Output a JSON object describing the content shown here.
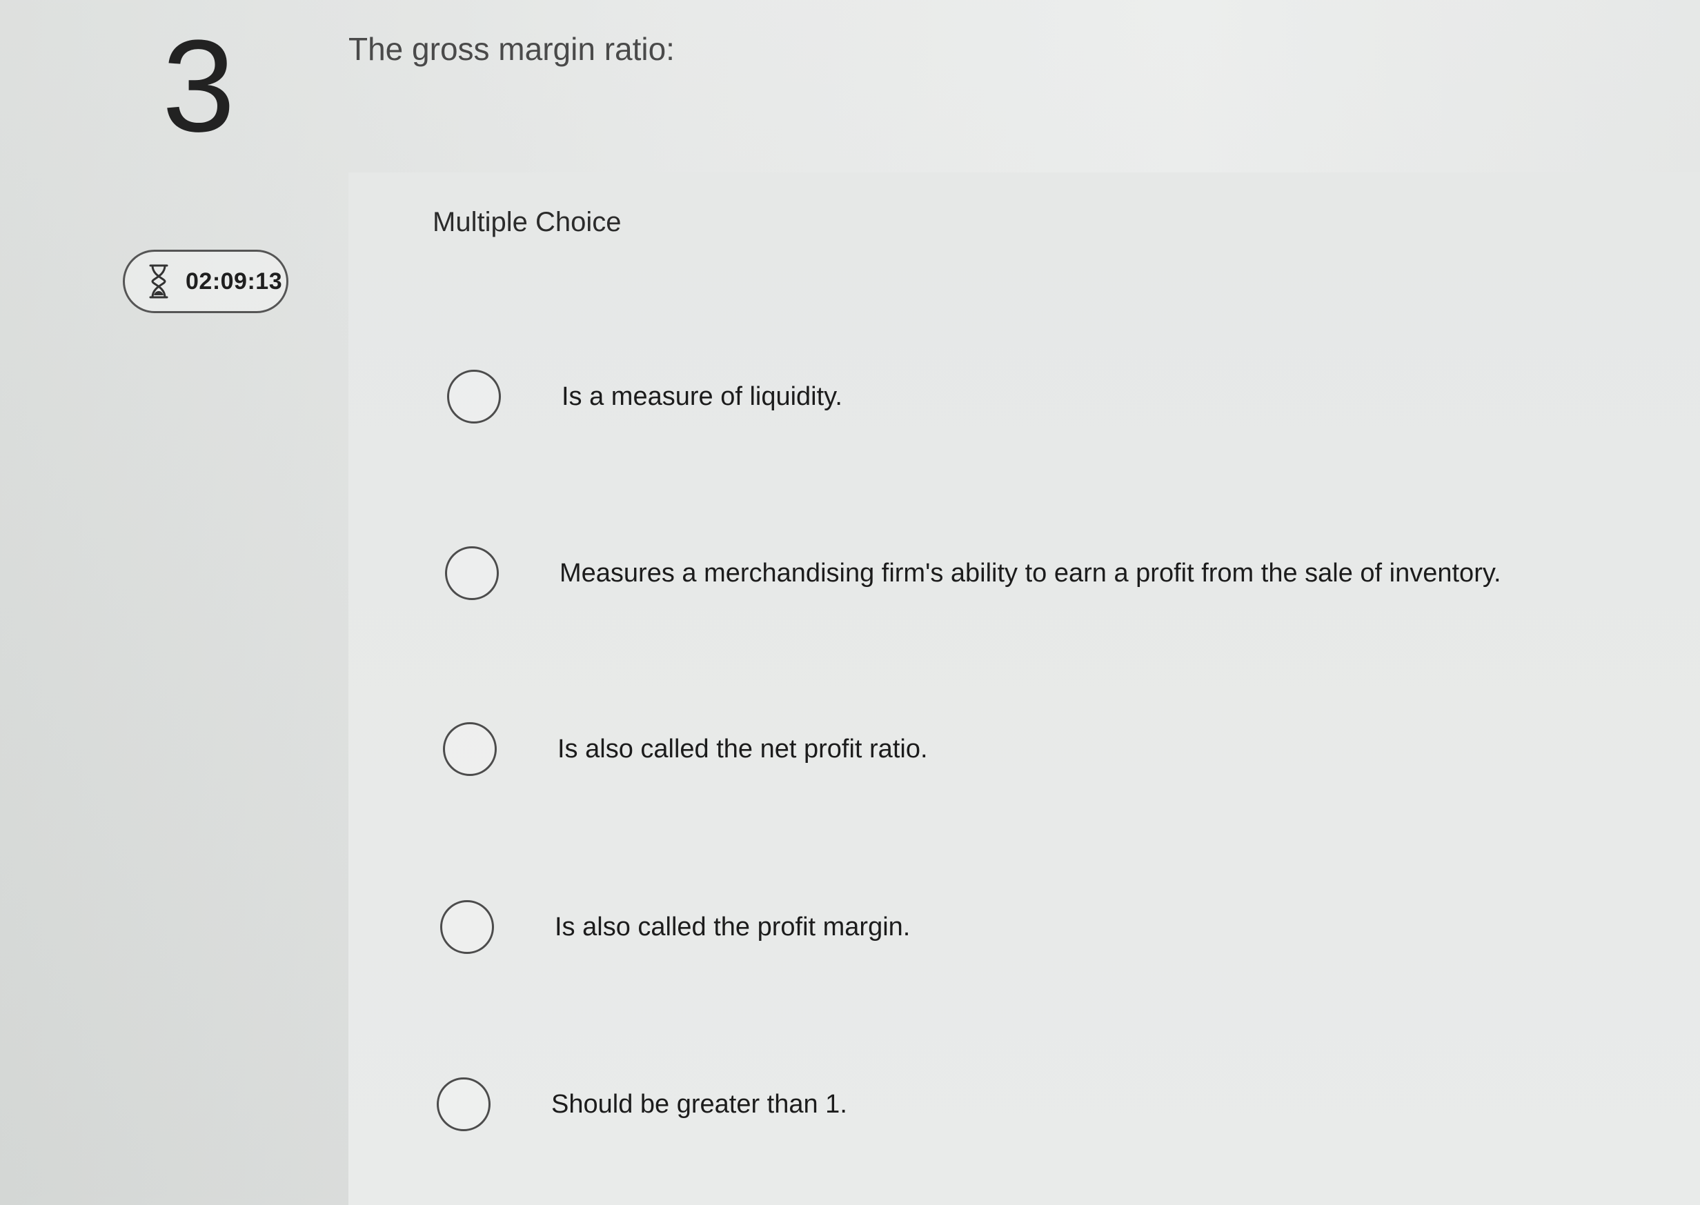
{
  "question": {
    "number": "3",
    "stem": "The gross margin ratio:",
    "type_label": "Multiple Choice"
  },
  "timer": {
    "icon": "hourglass-icon",
    "value": "02:09:13"
  },
  "options": [
    {
      "label": "Is a measure of liquidity."
    },
    {
      "label": "Measures a merchandising firm's ability to earn a profit from the sale of inventory."
    },
    {
      "label": "Is also called the net profit ratio."
    },
    {
      "label": "Is also called the profit margin."
    },
    {
      "label": "Should be greater than 1."
    }
  ],
  "colors": {
    "text": "#262626",
    "border": "#4c4c4c"
  }
}
